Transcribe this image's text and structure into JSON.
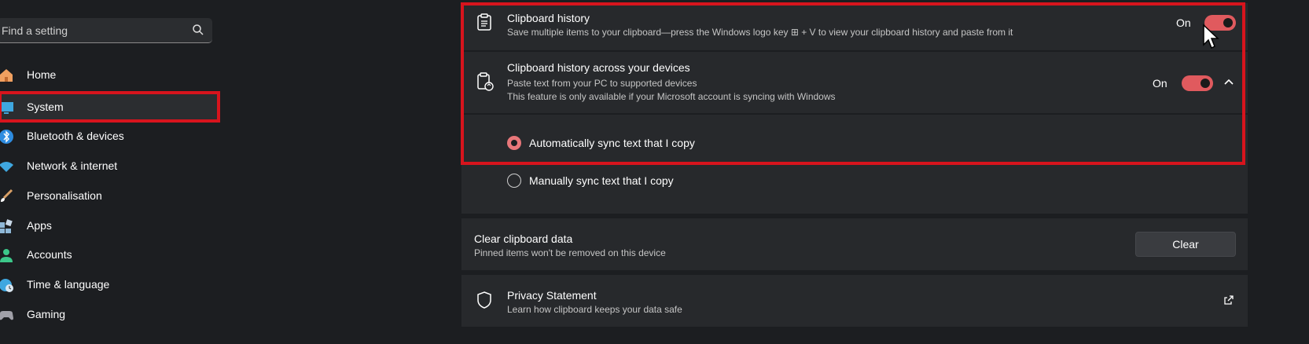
{
  "search": {
    "placeholder": "Find a setting"
  },
  "sidebar": {
    "items": [
      {
        "label": "Home",
        "icon": "home-icon"
      },
      {
        "label": "System",
        "icon": "system-icon"
      },
      {
        "label": "Bluetooth & devices",
        "icon": "bluetooth-icon"
      },
      {
        "label": "Network & internet",
        "icon": "wifi-icon"
      },
      {
        "label": "Personalisation",
        "icon": "brush-icon"
      },
      {
        "label": "Apps",
        "icon": "apps-icon"
      },
      {
        "label": "Accounts",
        "icon": "person-icon"
      },
      {
        "label": "Time & language",
        "icon": "globe-clock-icon"
      },
      {
        "label": "Gaming",
        "icon": "gamepad-icon"
      }
    ]
  },
  "clipboard_history": {
    "title": "Clipboard history",
    "subtitle": "Save multiple items to your clipboard—press the Windows logo key ⊞ + V to view your clipboard history and paste from it",
    "toggle_label": "On",
    "enabled": true
  },
  "across_devices": {
    "title": "Clipboard history across your devices",
    "subtitle_1": "Paste text from your PC to supported devices",
    "subtitle_2": "This feature is only available if your Microsoft account is syncing with Windows",
    "toggle_label": "On",
    "enabled": true,
    "options": [
      {
        "label": "Automatically sync text that I copy",
        "selected": true
      },
      {
        "label": "Manually sync text that I copy",
        "selected": false
      }
    ]
  },
  "clear_data": {
    "title": "Clear clipboard data",
    "subtitle": "Pinned items won't be removed on this device",
    "button_label": "Clear"
  },
  "privacy": {
    "title": "Privacy Statement",
    "subtitle": "Learn how clipboard keeps your data safe"
  },
  "colors": {
    "accent": "#e05a5e",
    "highlight": "#d7141d",
    "background": "#1c1e21",
    "card": "#27292c"
  }
}
